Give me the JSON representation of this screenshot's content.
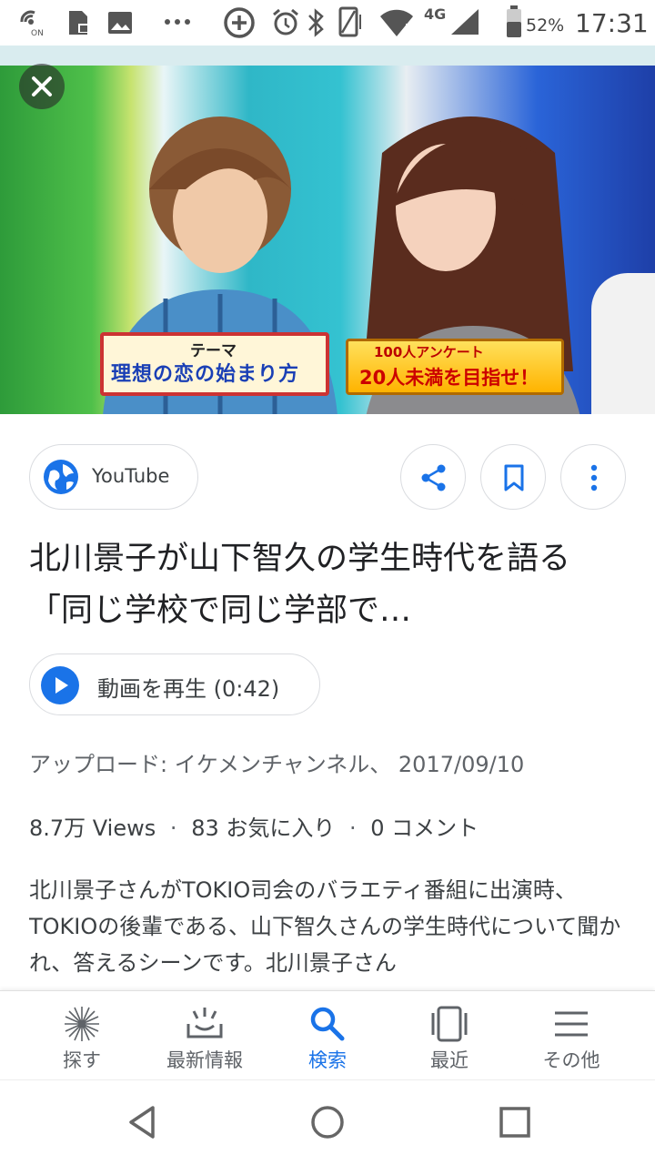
{
  "status_bar": {
    "battery_percent": "52%",
    "time": "17:31",
    "network": "4G",
    "nfc_badge": "ON"
  },
  "hero": {
    "caption_left_small": "テーマ",
    "caption_left_main": "理想の恋の始まり方",
    "caption_right_small": "100人アンケート",
    "caption_right_main": "20人未満を目指せ！"
  },
  "source": {
    "label": "YouTube",
    "icon": "globe-icon"
  },
  "actions": {
    "share_icon": "share-icon",
    "bookmark_icon": "bookmark-icon",
    "more_icon": "more-vert-icon"
  },
  "video": {
    "title": "北川景子が山下智久の学生時代を語る「同じ学校で同じ学部で…",
    "play_label": "動画を再生 (0:42)",
    "upload_line": "アップロード: イケメンチャンネル、 2017/09/10",
    "views": "8.7万 Views",
    "likes": "83 お気に入り",
    "comments": "0 コメント",
    "separator": "·",
    "description": "北川景子さんがTOKIO司会のバラエティ番組に出演時、TOKIOの後輩である、山下智久さんの学生時代について聞かれ、答えるシーンです。北川景子さん"
  },
  "bottom_nav": {
    "items": [
      {
        "label": "探す",
        "icon": "discover-icon"
      },
      {
        "label": "最新情報",
        "icon": "updates-icon"
      },
      {
        "label": "検索",
        "icon": "search-icon"
      },
      {
        "label": "最近",
        "icon": "recent-icon"
      },
      {
        "label": "その他",
        "icon": "menu-icon"
      }
    ],
    "active_index": 2
  },
  "colors": {
    "accent": "#1a73e8",
    "text_primary": "#202124",
    "text_secondary": "#5f6368",
    "border": "#dadce0"
  }
}
